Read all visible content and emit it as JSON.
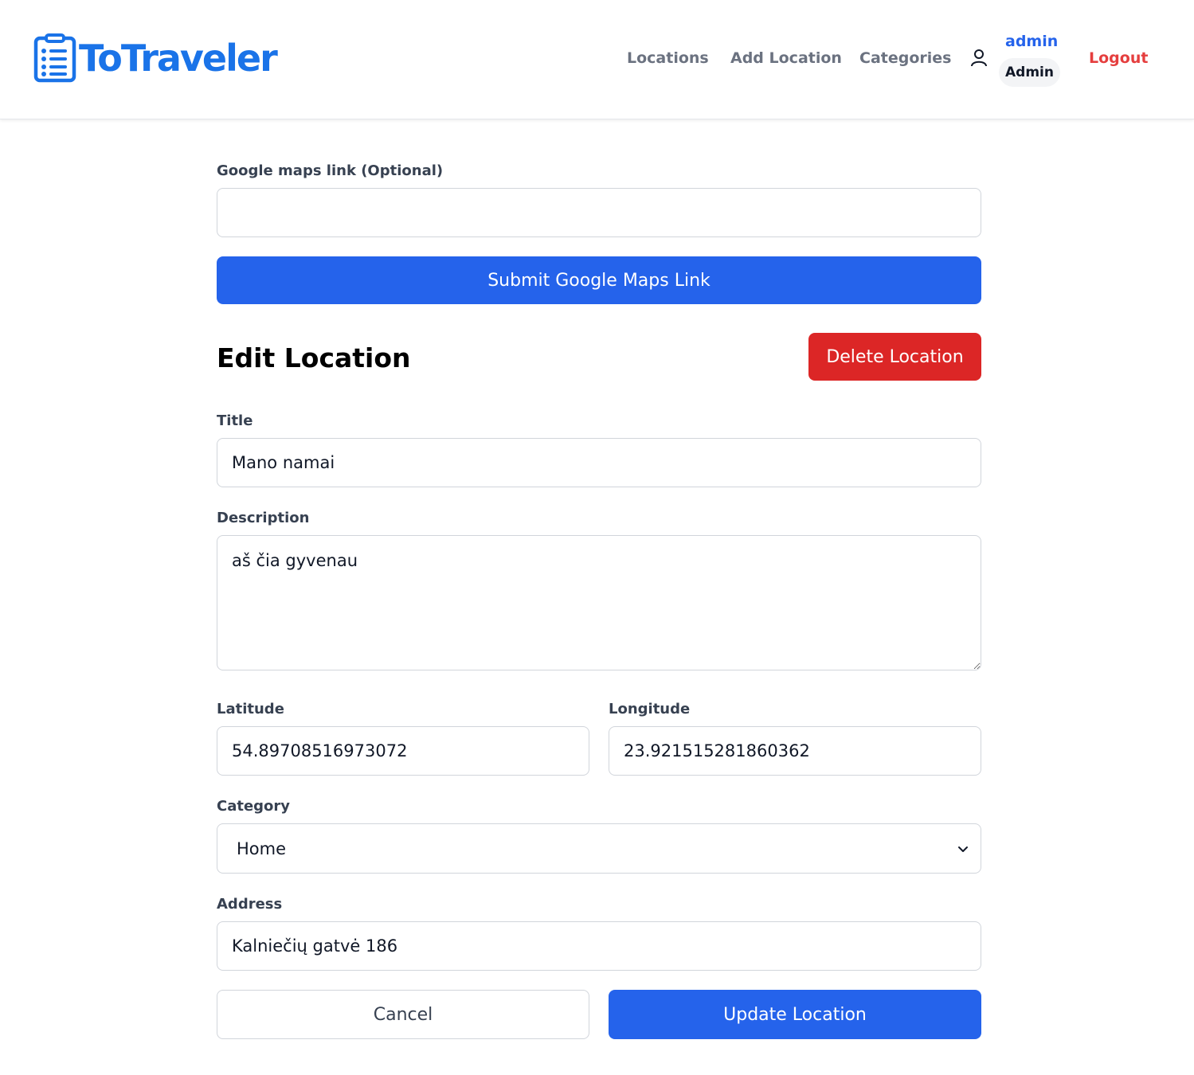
{
  "brand": {
    "name": "ToTraveler",
    "color": "#1a73e8",
    "icon": "checklist-icon"
  },
  "nav": {
    "links": [
      "Locations",
      "Add Location",
      "Categories"
    ],
    "user_icon": "user-icon",
    "username": "admin",
    "role": "Admin",
    "logout": "Logout"
  },
  "maps": {
    "label": "Google maps link (Optional)",
    "value": "",
    "submit_label": "Submit Google Maps Link"
  },
  "form": {
    "heading": "Edit Location",
    "delete_label": "Delete Location",
    "title_label": "Title",
    "title_value": "Mano namai",
    "description_label": "Description",
    "description_value": "aš čia gyvenau",
    "latitude_label": "Latitude",
    "latitude_value": "54.89708516973072",
    "longitude_label": "Longitude",
    "longitude_value": "23.921515281860362",
    "category_label": "Category",
    "category_value": "Home",
    "address_label": "Address",
    "address_value": "Kalniečių gatvė 186",
    "cancel_label": "Cancel",
    "update_label": "Update Location"
  },
  "colors": {
    "primary": "#2563eb",
    "danger": "#dc2626",
    "logout": "#e53e3e"
  }
}
